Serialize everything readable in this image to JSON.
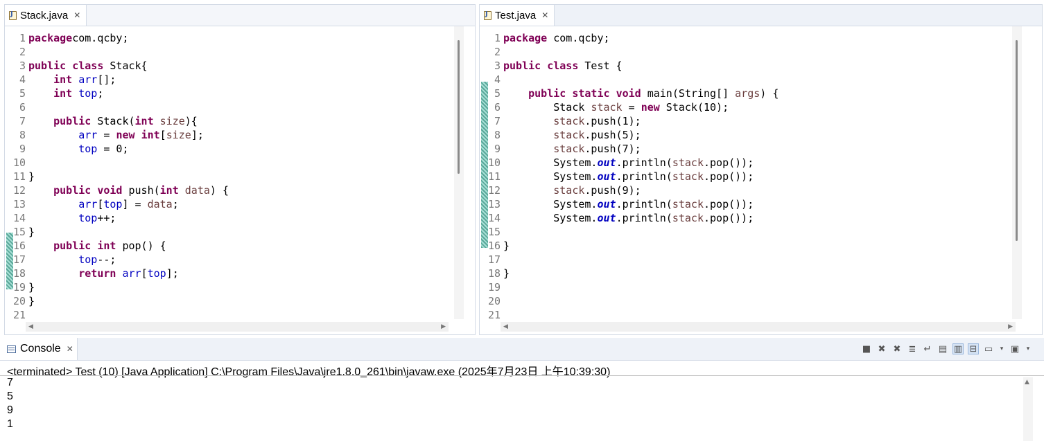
{
  "editors": [
    {
      "tab_label": "Stack.java",
      "lines": [
        [
          [
            "kw",
            "package"
          ],
          [
            "",
            "com.qcby;"
          ]
        ],
        [],
        [
          [
            "kw",
            "public"
          ],
          [
            "",
            " "
          ],
          [
            "kw",
            "class"
          ],
          [
            "",
            " Stack{"
          ]
        ],
        [
          [
            "",
            " "
          ],
          [
            "kw",
            "int"
          ],
          [
            "",
            " "
          ],
          [
            "fld",
            "arr"
          ],
          [
            "",
            "[];"
          ]
        ],
        [
          [
            "",
            " "
          ],
          [
            "kw",
            "int"
          ],
          [
            "",
            " "
          ],
          [
            "fld",
            "top"
          ],
          [
            "",
            ";"
          ]
        ],
        [],
        [
          [
            "",
            " "
          ],
          [
            "kw",
            "public"
          ],
          [
            "",
            " Stack("
          ],
          [
            "kw",
            "int"
          ],
          [
            "",
            " "
          ],
          [
            "var",
            "size"
          ],
          [
            "",
            "){"
          ]
        ],
        [
          [
            "",
            " "
          ],
          [
            "fld",
            "arr"
          ],
          [
            "",
            " = "
          ],
          [
            "kw",
            "new"
          ],
          [
            "",
            " "
          ],
          [
            "kw",
            "int"
          ],
          [
            "",
            "["
          ],
          [
            "var",
            "size"
          ],
          [
            "",
            "];"
          ]
        ],
        [
          [
            "",
            " "
          ],
          [
            "fld",
            "top"
          ],
          [
            "",
            " = 0;"
          ]
        ],
        [],
        [
          [
            "",
            " }"
          ]
        ],
        [
          [
            "",
            " "
          ],
          [
            "kw",
            "public"
          ],
          [
            "",
            " "
          ],
          [
            "kw",
            "void"
          ],
          [
            "",
            " push("
          ],
          [
            "kw",
            "int"
          ],
          [
            "",
            " "
          ],
          [
            "var",
            "data"
          ],
          [
            "",
            ") {"
          ]
        ],
        [
          [
            "",
            " "
          ],
          [
            "fld",
            "arr"
          ],
          [
            "",
            "["
          ],
          [
            "fld",
            "top"
          ],
          [
            "",
            "] = "
          ],
          [
            "var",
            "data"
          ],
          [
            "",
            ";"
          ]
        ],
        [
          [
            "",
            " "
          ],
          [
            "fld",
            "top"
          ],
          [
            "",
            "++;"
          ]
        ],
        [
          [
            "",
            " }"
          ]
        ],
        [
          [
            "",
            " "
          ],
          [
            "kw",
            "public"
          ],
          [
            "",
            " "
          ],
          [
            "kw",
            "int"
          ],
          [
            "",
            " pop() {"
          ]
        ],
        [
          [
            "",
            " "
          ],
          [
            "fld",
            "top"
          ],
          [
            "",
            "--;"
          ]
        ],
        [
          [
            "",
            " "
          ],
          [
            "kw",
            "return"
          ],
          [
            "",
            " "
          ],
          [
            "fld",
            "arr"
          ],
          [
            "",
            "["
          ],
          [
            "fld",
            "top"
          ],
          [
            "",
            "];"
          ]
        ],
        [
          [
            "",
            " }"
          ]
        ],
        [
          [
            "",
            "}"
          ]
        ],
        []
      ]
    },
    {
      "tab_label": "Test.java",
      "lines": [
        [
          [
            "kw",
            "package"
          ],
          [
            "",
            " com.qcby;"
          ]
        ],
        [],
        [
          [
            "kw",
            "public"
          ],
          [
            "",
            " "
          ],
          [
            "kw",
            "class"
          ],
          [
            "",
            " Test {"
          ]
        ],
        [],
        [
          [
            "",
            " "
          ],
          [
            "kw",
            "public"
          ],
          [
            "",
            " "
          ],
          [
            "kw",
            "static"
          ],
          [
            "",
            " "
          ],
          [
            "kw",
            "void"
          ],
          [
            "",
            " main(String[] "
          ],
          [
            "var",
            "args"
          ],
          [
            "",
            ") {"
          ]
        ],
        [
          [
            "",
            " Stack "
          ],
          [
            "var",
            "stack"
          ],
          [
            "",
            " = "
          ],
          [
            "kw",
            "new"
          ],
          [
            "",
            " Stack(10);"
          ]
        ],
        [
          [
            "",
            " "
          ],
          [
            "var",
            "stack"
          ],
          [
            "",
            ".push(1);"
          ]
        ],
        [
          [
            "",
            " "
          ],
          [
            "var",
            "stack"
          ],
          [
            "",
            ".push(5);"
          ]
        ],
        [
          [
            "",
            " "
          ],
          [
            "var",
            "stack"
          ],
          [
            "",
            ".push(7);"
          ]
        ],
        [
          [
            "",
            " System."
          ],
          [
            "sf",
            "out"
          ],
          [
            "",
            ".println("
          ],
          [
            "var",
            "stack"
          ],
          [
            "",
            ".pop());"
          ]
        ],
        [
          [
            "",
            " System."
          ],
          [
            "sf",
            "out"
          ],
          [
            "",
            ".println("
          ],
          [
            "var",
            "stack"
          ],
          [
            "",
            ".pop());"
          ]
        ],
        [
          [
            "",
            " "
          ],
          [
            "var",
            "stack"
          ],
          [
            "",
            ".push(9);"
          ]
        ],
        [
          [
            "",
            " System."
          ],
          [
            "sf",
            "out"
          ],
          [
            "",
            ".println("
          ],
          [
            "var",
            "stack"
          ],
          [
            "",
            ".pop());"
          ]
        ],
        [
          [
            "",
            " System."
          ],
          [
            "sf",
            "out"
          ],
          [
            "",
            ".println("
          ],
          [
            "var",
            "stack"
          ],
          [
            "",
            ".pop());"
          ]
        ],
        [],
        [
          [
            "",
            " }"
          ]
        ],
        [],
        [
          [
            "",
            "}"
          ]
        ],
        [],
        [],
        []
      ]
    }
  ],
  "console": {
    "tab_label": "Console",
    "status": "<terminated> Test (10) [Java Application] C:\\Program Files\\Java\\jre1.8.0_261\\bin\\javaw.exe (2025年7月23日 上午10:39:30)",
    "output": [
      "7",
      "5",
      "9",
      "1"
    ],
    "toolbar_icons": [
      "terminate-icon",
      "remove-launch-icon",
      "remove-all-terminated-icon",
      "scroll-lock-icon",
      "word-wrap-icon",
      "show-console-on-output-icon",
      "show-console-on-error-icon",
      "pin-console-icon",
      "display-selected-console-icon",
      "display-selected-console-dropdown-icon",
      "open-console-icon",
      "open-console-dropdown-icon"
    ]
  }
}
